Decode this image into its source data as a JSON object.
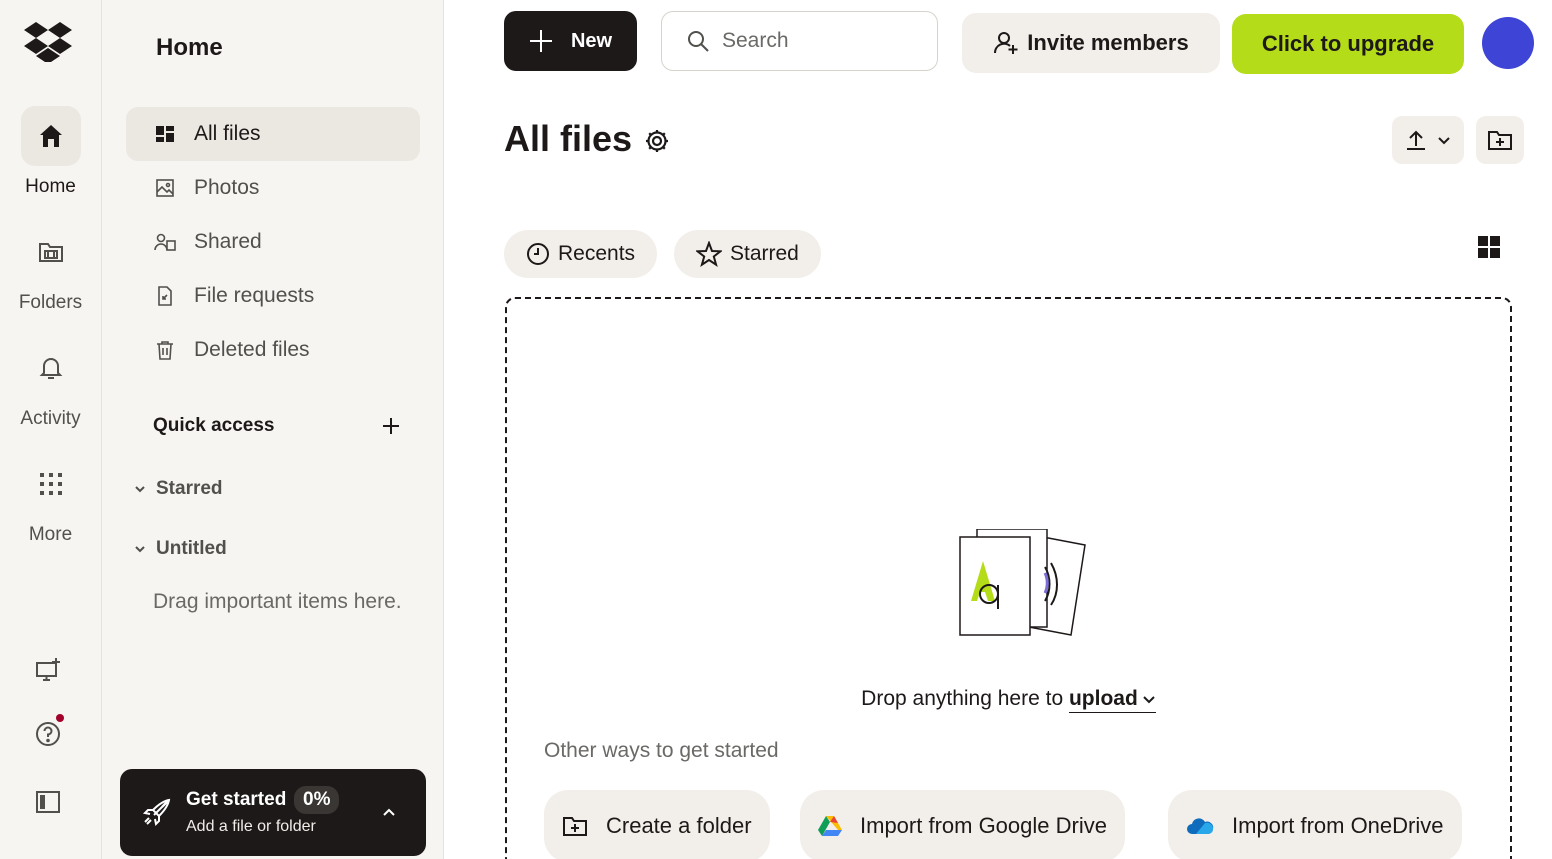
{
  "rail": {
    "items": [
      {
        "label": "Home",
        "icon": "home-icon"
      },
      {
        "label": "Folders",
        "icon": "folders-icon"
      },
      {
        "label": "Activity",
        "icon": "bell-icon"
      },
      {
        "label": "More",
        "icon": "apps-grid-icon"
      }
    ],
    "bottom_icons": [
      "desktop-app-icon",
      "help-icon",
      "sidebar-toggle-icon"
    ],
    "notification_color": "#a3002b"
  },
  "sidebar": {
    "title": "Home",
    "nav": [
      {
        "label": "All files",
        "icon": "all-files-icon"
      },
      {
        "label": "Photos",
        "icon": "photos-icon"
      },
      {
        "label": "Shared",
        "icon": "shared-icon"
      },
      {
        "label": "File requests",
        "icon": "file-request-icon"
      },
      {
        "label": "Deleted files",
        "icon": "trash-icon"
      }
    ],
    "quick_access": {
      "title": "Quick access",
      "groups": [
        "Starred",
        "Untitled"
      ],
      "hint": "Drag important items here."
    },
    "get_started": {
      "title": "Get started",
      "percent": "0%",
      "subtitle": "Add a file or folder"
    }
  },
  "topbar": {
    "new_label": "New",
    "search_placeholder": "Search",
    "invite_label": "Invite members",
    "upgrade_label": "Click to upgrade",
    "upgrade_color": "#b4dc19",
    "avatar_color": "#3d44d6"
  },
  "main": {
    "title": "All files",
    "tabs": [
      {
        "label": "Recents",
        "icon": "clock-icon"
      },
      {
        "label": "Starred",
        "icon": "star-icon"
      }
    ],
    "dropzone": {
      "text": "Drop anything here to",
      "upload_label": "upload",
      "other_ways": "Other ways to get started",
      "actions": [
        {
          "label": "Create a folder",
          "icon": "new-folder-icon"
        },
        {
          "label": "Import from Google Drive",
          "icon": "google-drive-icon"
        },
        {
          "label": "Import from OneDrive",
          "icon": "onedrive-icon"
        }
      ]
    }
  }
}
